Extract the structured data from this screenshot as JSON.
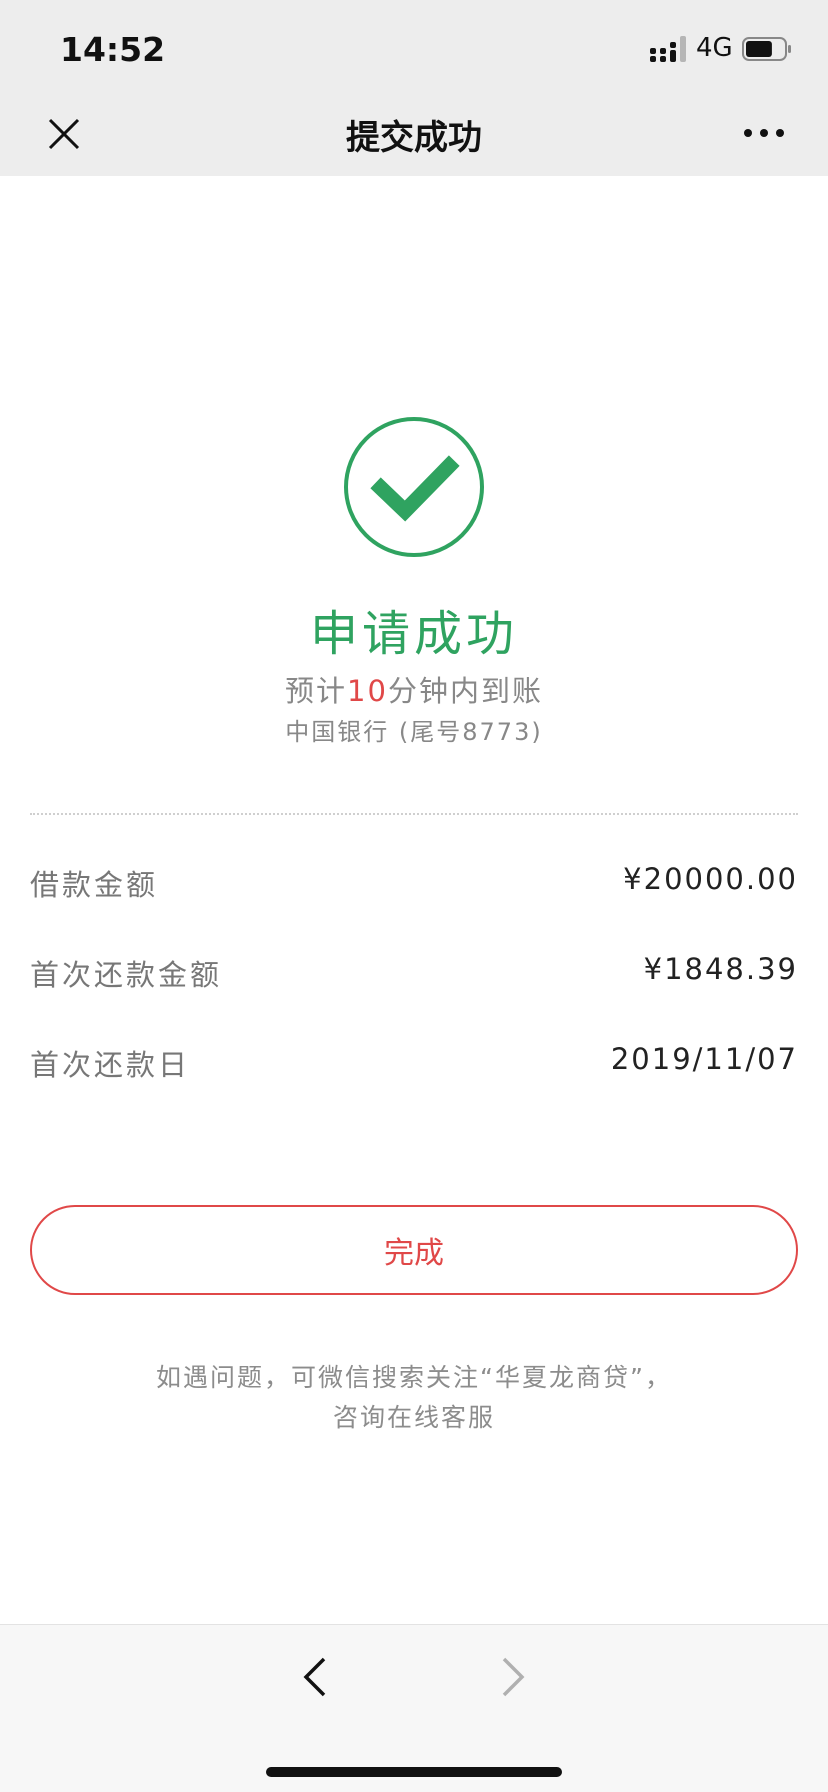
{
  "status_bar": {
    "time": "14:52",
    "network": "4G",
    "battery_level": 0.7
  },
  "nav": {
    "title": "提交成功"
  },
  "result": {
    "title": "申请成功",
    "eta_prefix": "预计",
    "eta_highlight": "10",
    "eta_suffix": "分钟内到账",
    "bank": "中国银行 (尾号8773)"
  },
  "details": [
    {
      "label": "借款金额",
      "value": "¥20000.00"
    },
    {
      "label": "首次还款金额",
      "value": "¥1848.39"
    },
    {
      "label": "首次还款日",
      "value": "2019/11/07"
    }
  ],
  "done_button": {
    "label": "完成"
  },
  "help": {
    "line1": "如遇问题，可微信搜索关注“华夏龙商贷”，",
    "line2": "咨询在线客服"
  },
  "colors": {
    "success": "#2fa360",
    "accent": "#e04848"
  }
}
